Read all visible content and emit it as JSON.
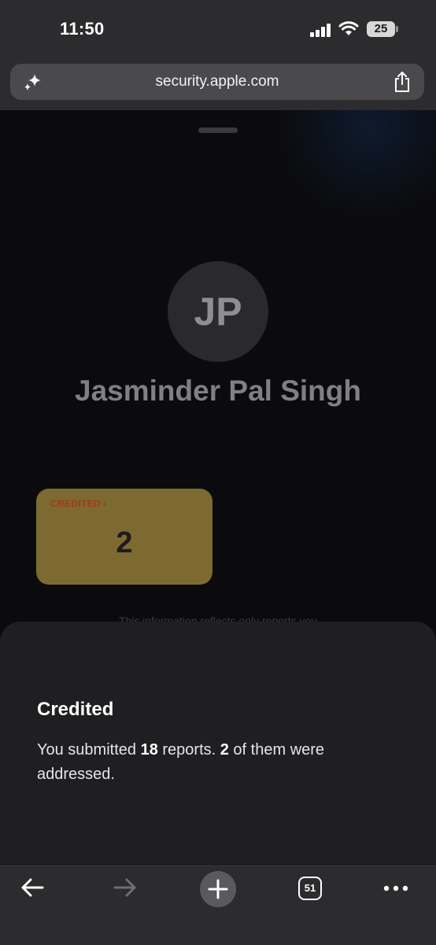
{
  "status_bar": {
    "time": "11:50",
    "battery": "25"
  },
  "browser": {
    "url": "security.apple.com",
    "tab_count": "51"
  },
  "profile": {
    "initials": "JP",
    "name": "Jasminder Pal Singh"
  },
  "credited_card": {
    "label": "CREDITED ›",
    "value": "2",
    "color": "#7c6a31"
  },
  "background_text": "This information reflects only reports you",
  "sheet": {
    "title": "Credited",
    "body_prefix": "You submitted ",
    "reports_submitted": "18",
    "body_middle": " reports. ",
    "reports_addressed": "2",
    "body_suffix": " of them were addressed."
  },
  "toolbar": {
    "icons": [
      "back-arrow-icon",
      "forward-arrow-icon",
      "plus-icon",
      "tabs-icon",
      "more-icon"
    ]
  }
}
